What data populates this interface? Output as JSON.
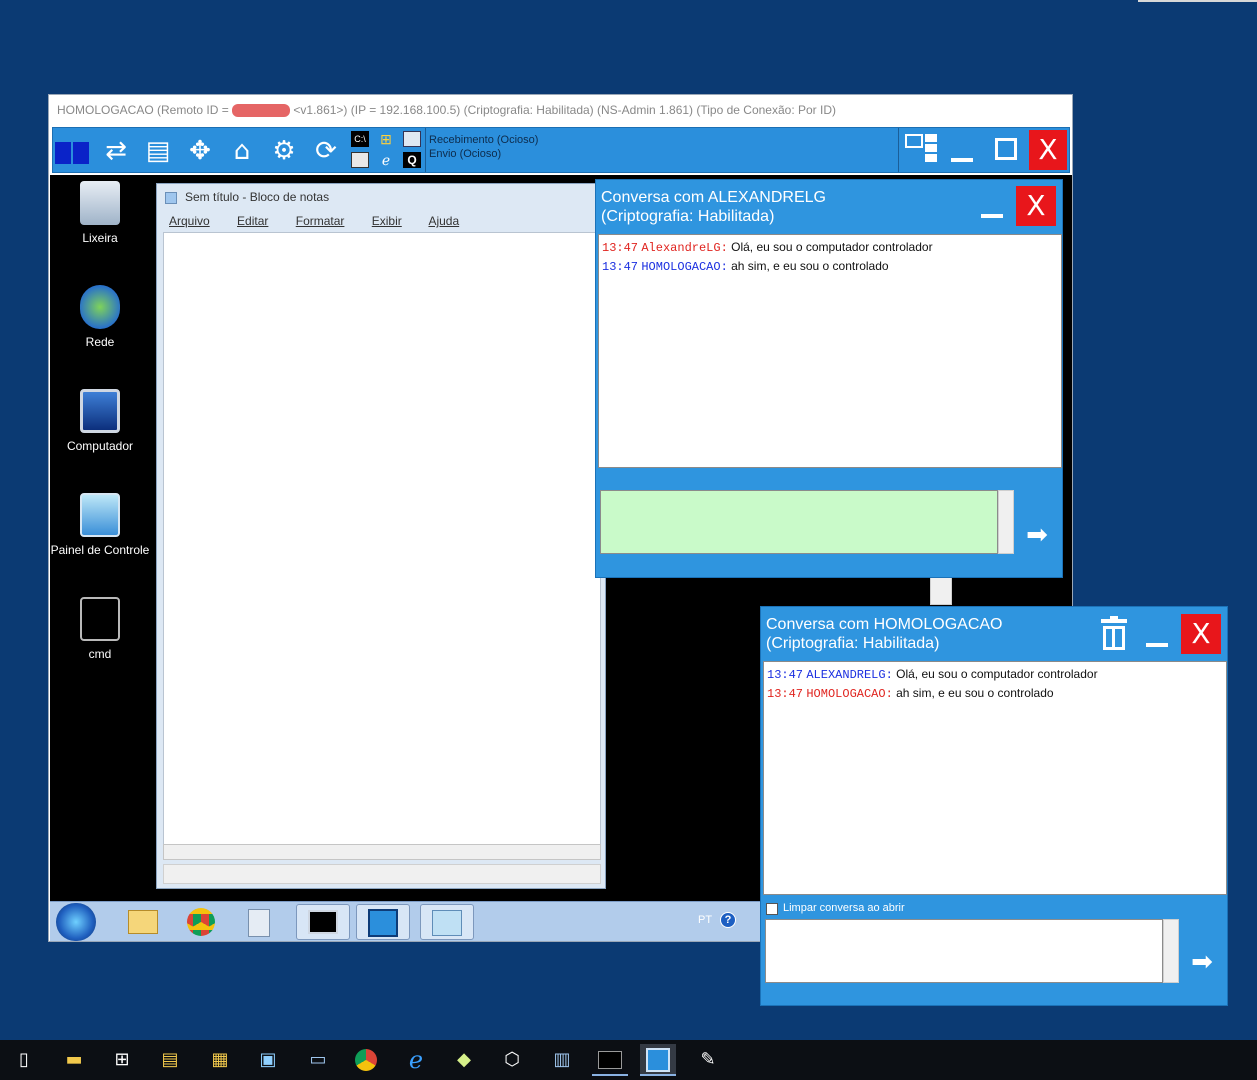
{
  "remote": {
    "title_prefix": "HOMOLOGACAO (Remoto ID = ",
    "title_suffix": " <v1.861>) (IP = 192.168.100.5)  (Criptografia: Habilitada) (NS-Admin 1.861) (Tipo de Conexão: Por ID)",
    "status_receiving": "Recebimento (Ocioso)",
    "status_sending": "Envio (Ocioso)",
    "close_label": "X",
    "toolbar_icons": [
      "screen-icon",
      "transfer-icon",
      "chat-icon",
      "move-icon",
      "home-icon",
      "settings-icon",
      "refresh-icon",
      "cmd-icon",
      "windows-icon",
      "keyboard-icon",
      "ie-icon",
      "monitor-icon",
      "q-icon"
    ]
  },
  "desktop_icons": [
    {
      "label": "Lixeira",
      "icon": "recycle-bin-icon"
    },
    {
      "label": "Rede",
      "icon": "network-icon"
    },
    {
      "label": "Computador",
      "icon": "computer-icon"
    },
    {
      "label": "Painel de Controle",
      "icon": "control-panel-icon"
    },
    {
      "label": "cmd",
      "icon": "cmd-shortcut-icon"
    }
  ],
  "notepad": {
    "title": "Sem título - Bloco de notas",
    "menu": [
      "Arquivo",
      "Editar",
      "Formatar",
      "Exibir",
      "Ajuda"
    ]
  },
  "remote_taskbar": {
    "lang": "PT"
  },
  "chat1": {
    "title_line1": "Conversa com ALEXANDRELG",
    "title_line2": "(Criptografia: Habilitada)",
    "close_label": "X",
    "messages": [
      {
        "time": "13:47",
        "sender": "AlexandreLG:",
        "text": "Olá, eu sou o computador controlador"
      },
      {
        "time": "13:47",
        "sender": "HOMOLOGACAO:",
        "text": "ah sim, e eu sou o controlado"
      }
    ],
    "input_value": ""
  },
  "chat2": {
    "title_line1": "Conversa com HOMOLOGACAO",
    "title_line2": "(Criptografia: Habilitada)",
    "close_label": "X",
    "messages": [
      {
        "time": "13:47",
        "sender": "ALEXANDRELG:",
        "text": "Olá, eu sou o computador controlador"
      },
      {
        "time": "13:47",
        "sender": "HOMOLOGACAO:",
        "text": "ah sim, e eu sou o controlado"
      }
    ],
    "clear_label": "Limpar conversa ao abrir",
    "clear_checked": false,
    "input_value": ""
  },
  "colors": {
    "desktop_bg": "#0b3a73",
    "chat_blue": "#2f95df",
    "close_red": "#e8161b",
    "chat_input_green": "#c9fac9"
  }
}
